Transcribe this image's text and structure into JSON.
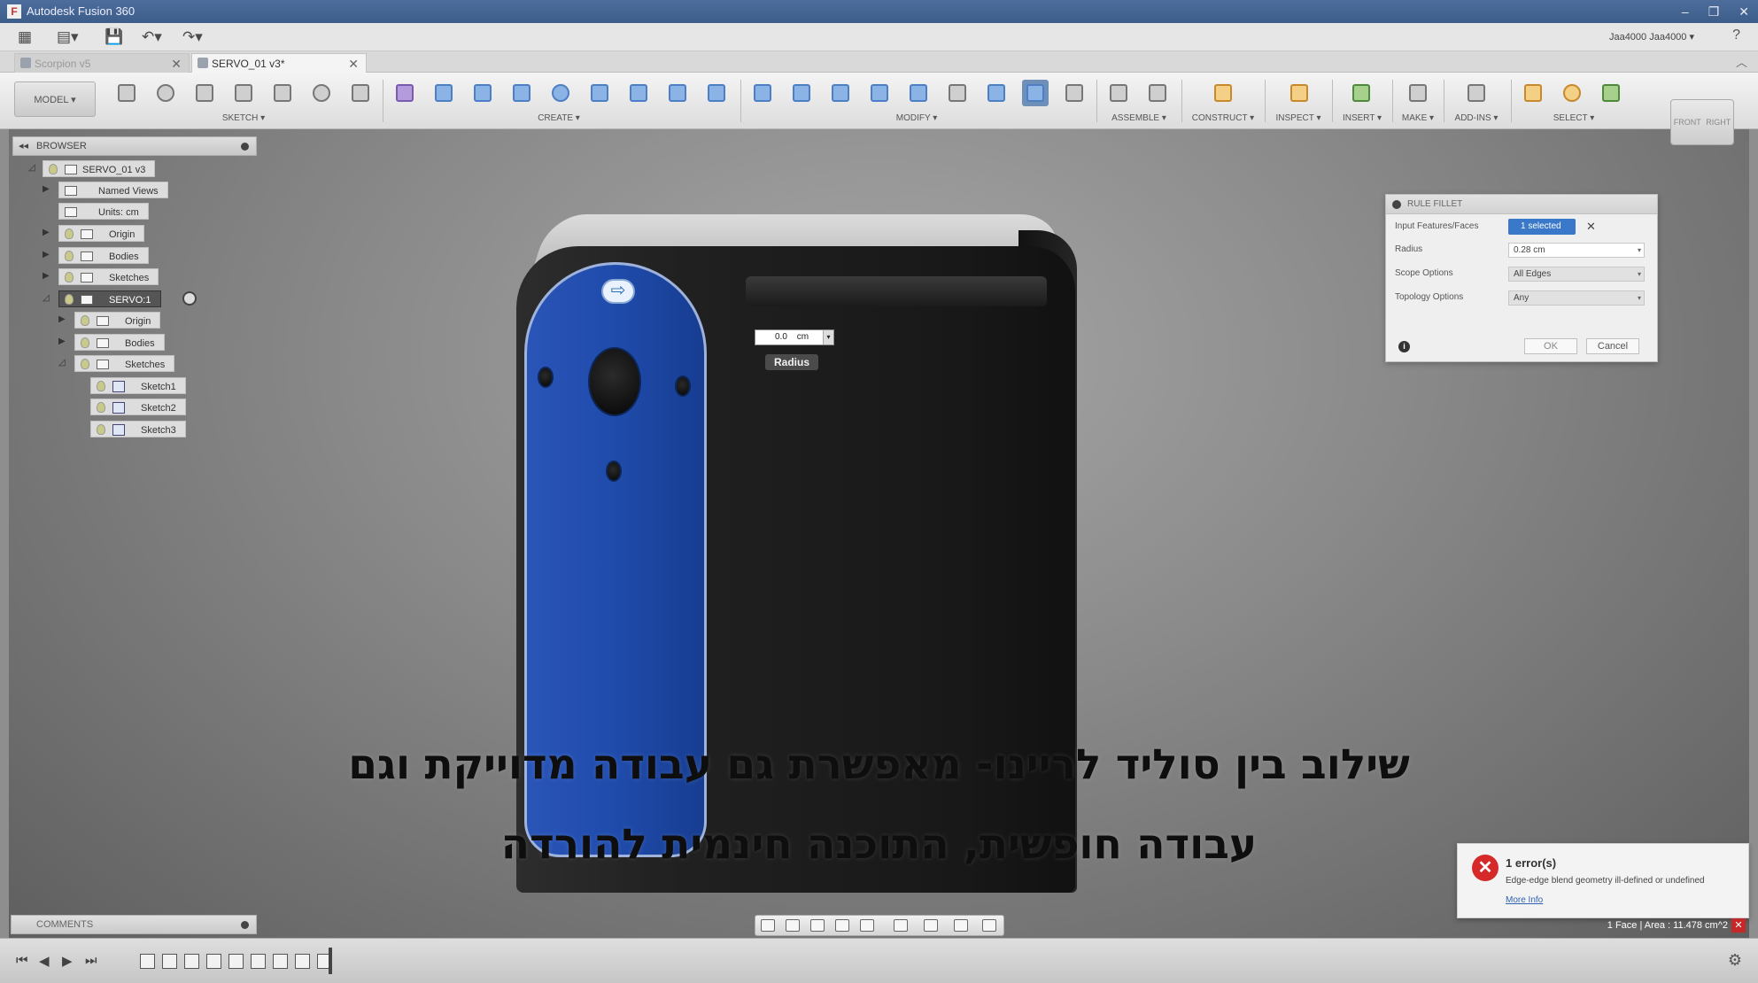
{
  "window": {
    "title": "Autodesk Fusion 360",
    "controls": [
      "–",
      "❐",
      "✕"
    ]
  },
  "user": {
    "name": "Jaa4000 Jaa4000 ▾",
    "help": "?"
  },
  "tabs": [
    {
      "label": "Scorpion v5",
      "active": false
    },
    {
      "label": "SERVO_01 v3*",
      "active": true
    }
  ],
  "toolbar": {
    "mode": "MODEL ▾",
    "groups": [
      "SKETCH ▾",
      "CREATE ▾",
      "MODIFY ▾",
      "ASSEMBLE ▾",
      "CONSTRUCT ▾",
      "INSPECT ▾",
      "INSERT ▾",
      "MAKE ▾",
      "ADD-INS ▾",
      "SELECT ▾"
    ]
  },
  "viewcube": {
    "front": "FRONT",
    "right": "RIGHT"
  },
  "browser": {
    "title": "BROWSER",
    "items": [
      {
        "label": "SERVO_01 v3"
      },
      {
        "label": "Named Views"
      },
      {
        "label": "Units: cm"
      },
      {
        "label": "Origin"
      },
      {
        "label": "Bodies"
      },
      {
        "label": "Sketches"
      },
      {
        "label": "SERVO:1"
      },
      {
        "label": "Origin"
      },
      {
        "label": "Bodies"
      },
      {
        "label": "Sketches"
      },
      {
        "label": "Sketch1"
      },
      {
        "label": "Sketch2"
      },
      {
        "label": "Sketch3"
      }
    ]
  },
  "canvas": {
    "dim_value": "0.0",
    "dim_unit": "cm",
    "tooltip": "Radius",
    "subtitle_line1": "שילוב בין סוליד לריינו- מאפשרת גם עבודה מדוייקת וגם",
    "subtitle_line2": "עבודה חופשית, התוכנה חינמית להורדה"
  },
  "dialog": {
    "title": "RULE FILLET",
    "input_label": "Input Features/Faces",
    "input_value": "1 selected",
    "radius_label": "Radius",
    "radius_value": "0.28 cm",
    "scope_label": "Scope Options",
    "scope_value": "All Edges",
    "topology_label": "Topology Options",
    "topology_value": "Any",
    "ok": "OK",
    "cancel": "Cancel"
  },
  "error": {
    "count": "1 error(s)",
    "message": "Edge-edge blend geometry ill-defined or undefined",
    "link": "More Info"
  },
  "comments": {
    "title": "COMMENTS"
  },
  "status": {
    "text": "1 Face | Area : 11.478 cm^2"
  },
  "colors": {
    "selected_face": "#1f4bab",
    "accent": "#3a78c9",
    "error": "#d62a2a"
  }
}
